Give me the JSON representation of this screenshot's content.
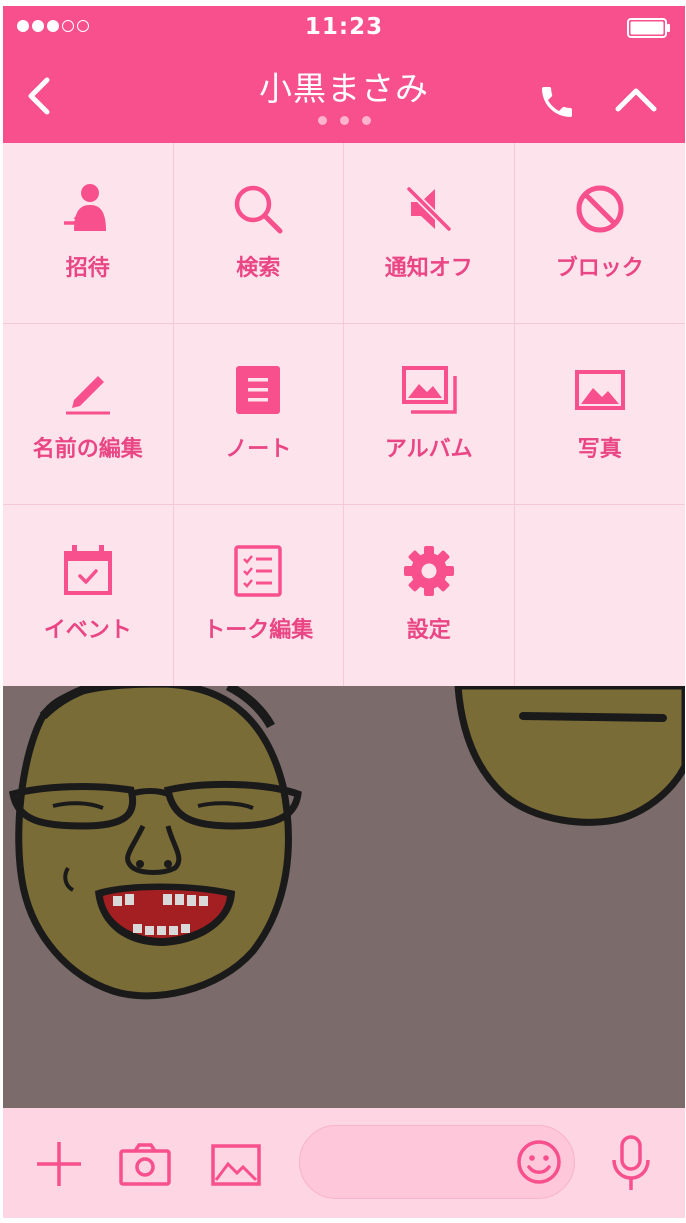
{
  "status_bar": {
    "time": "11:23",
    "signal_filled": 3,
    "signal_total": 5
  },
  "header": {
    "title": "小黒まさみ",
    "page_indicator_count": 3
  },
  "menu": {
    "items": [
      {
        "label": "招待",
        "icon": "invite-icon"
      },
      {
        "label": "検索",
        "icon": "search-icon"
      },
      {
        "label": "通知オフ",
        "icon": "mute-icon"
      },
      {
        "label": "ブロック",
        "icon": "block-icon"
      },
      {
        "label": "名前の編集",
        "icon": "pencil-icon"
      },
      {
        "label": "ノート",
        "icon": "note-icon"
      },
      {
        "label": "アルバム",
        "icon": "album-icon"
      },
      {
        "label": "写真",
        "icon": "photo-icon"
      },
      {
        "label": "イベント",
        "icon": "calendar-icon"
      },
      {
        "label": "トーク編集",
        "icon": "checklist-icon"
      },
      {
        "label": "設定",
        "icon": "gear-icon"
      }
    ]
  },
  "colors": {
    "accent": "#f7508d",
    "menu_bg": "#fde4ec",
    "label": "#ea4584",
    "chat_bg": "#7b6b6b",
    "input_bar": "#fdd5e3"
  }
}
